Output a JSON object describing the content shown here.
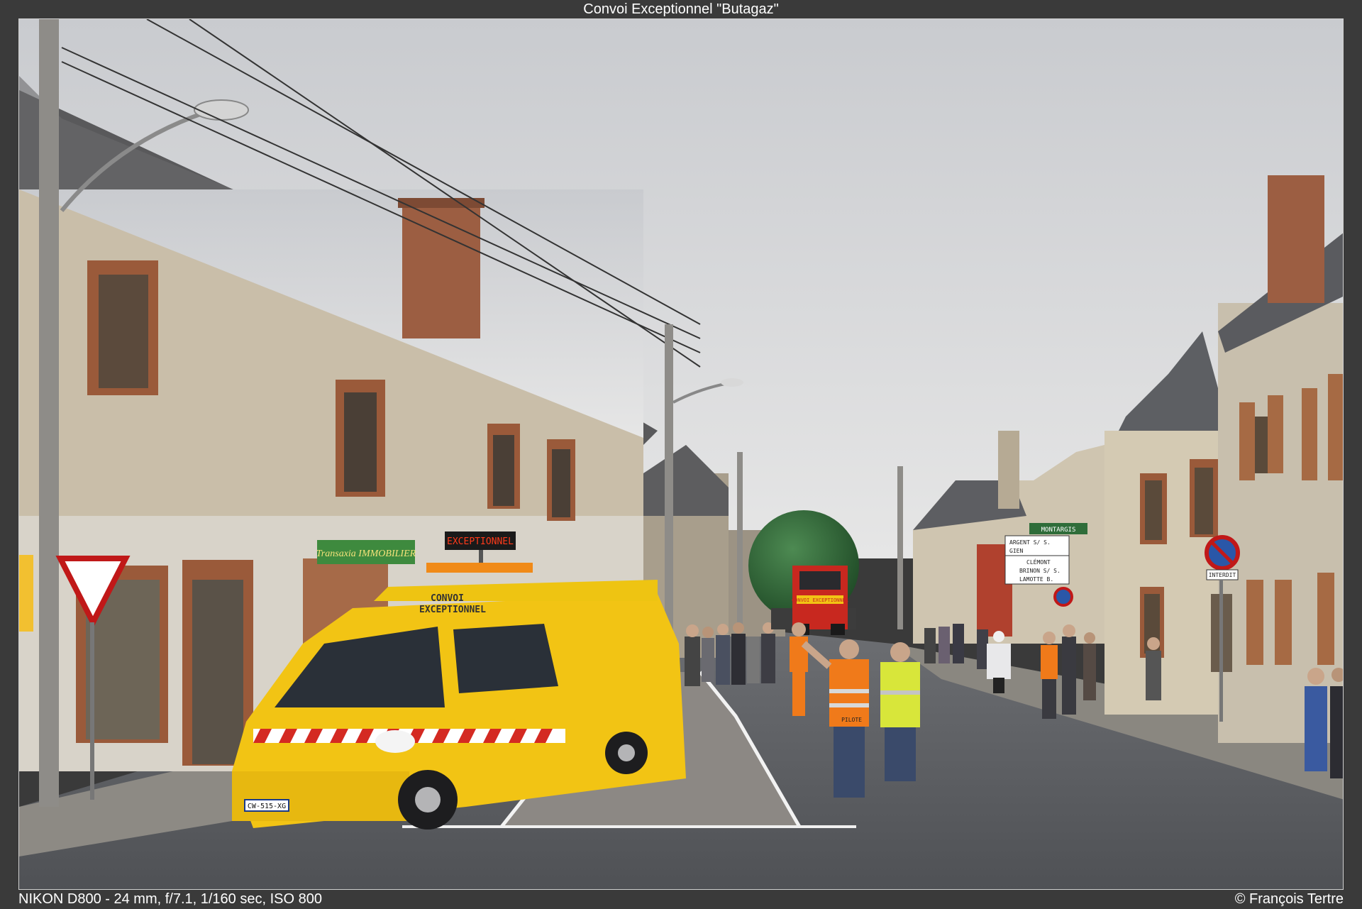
{
  "frame": {
    "title": "Convoi Exceptionnel \"Butagaz\"",
    "camera_info": "NIKON D800 - 24 mm, f/7.1, 1/160 sec, ISO 800",
    "copyright": "© François Tertre"
  },
  "scene_text": {
    "led_sign": "EXCEPTIONNEL",
    "van_roof_label_1": "CONVOI",
    "van_roof_label_2": "EXCEPTIONNEL",
    "license_plate": "CW-515-XG",
    "shop_sign": "Transaxia IMMOBILIER",
    "truck_banner": "CONVOI EXCEPTIONNEL",
    "road_sign_top": "MONTARGIS",
    "road_sign_1": "ARGENT S/ S.",
    "road_sign_2": "GIEN",
    "road_sign_3": "CLÉMONT",
    "road_sign_4": "BRINON S/ S.",
    "road_sign_5": "LAMOTTE B.",
    "interdit_sign": "INTERDIT",
    "vest_label": "PILOTE"
  },
  "colors": {
    "sky": "#d9dadc",
    "wall": "#cbbfa9",
    "roof": "#5a5a5c",
    "brick": "#9a5a3a",
    "van_yellow": "#f2c414",
    "tank_green": "#2f6a38",
    "truck_red": "#c8281f",
    "safety_orange": "#f07a1a",
    "hiviz_yellow": "#d8e63a",
    "road": "#5d5f63"
  }
}
